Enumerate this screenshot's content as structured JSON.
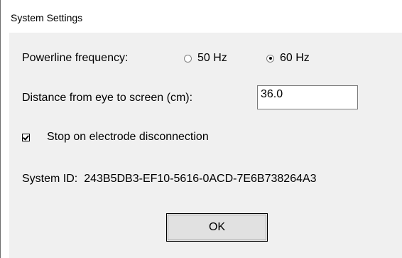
{
  "window": {
    "title": "System Settings"
  },
  "powerline": {
    "label": "Powerline frequency:",
    "options": [
      {
        "label": "50 Hz",
        "checked": false
      },
      {
        "label": "60 Hz",
        "checked": true
      }
    ]
  },
  "distance": {
    "label": "Distance from eye to screen (cm):",
    "value": "36.0"
  },
  "stop_on_disconnect": {
    "label": "Stop on electrode disconnection",
    "checked": true
  },
  "system_id": {
    "label": "System ID:",
    "value": "243B5DB3-EF10-5616-0ACD-7E6B738264A3"
  },
  "buttons": {
    "ok_label": "OK"
  }
}
